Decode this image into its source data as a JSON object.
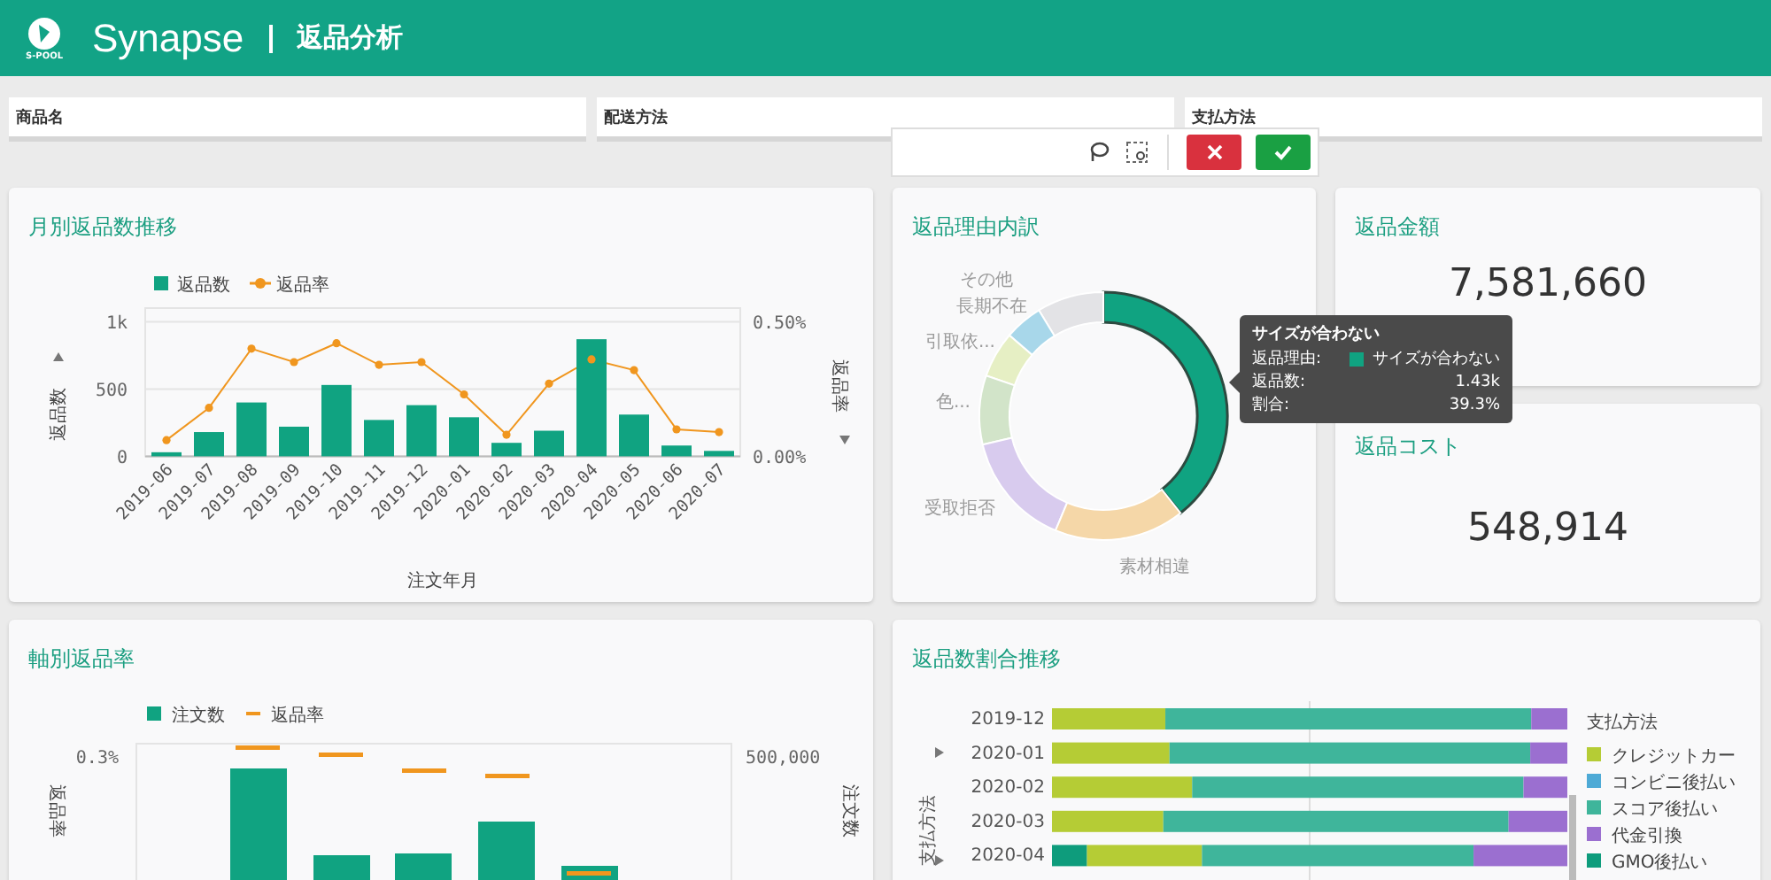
{
  "header": {
    "logo_caption": "S-POOL",
    "app_name": "Synapse",
    "page_title": "返品分析"
  },
  "filters": [
    {
      "label": "商品名"
    },
    {
      "label": "配送方法"
    },
    {
      "label": "支払方法"
    }
  ],
  "monthly_returns": {
    "title": "月別返品数推移",
    "chart_data": {
      "type": "bar",
      "xlabel": "注文年月",
      "ylabel": "返品数",
      "y2label": "返品率",
      "categories": [
        "2019-06",
        "2019-07",
        "2019-08",
        "2019-09",
        "2019-10",
        "2019-11",
        "2019-12",
        "2020-01",
        "2020-02",
        "2020-03",
        "2020-04",
        "2020-05",
        "2020-06",
        "2020-07"
      ],
      "legend": "top",
      "series": [
        {
          "name": "返品数",
          "color": "#10a381",
          "type": "bar",
          "values": [
            30,
            180,
            400,
            220,
            530,
            270,
            380,
            290,
            100,
            190,
            870,
            310,
            80,
            40
          ]
        },
        {
          "name": "返品率",
          "color": "#f0961e",
          "type": "line",
          "axis": "y2",
          "marker": "circle",
          "values": [
            0.06,
            0.18,
            0.4,
            0.35,
            0.42,
            0.34,
            0.35,
            0.23,
            0.08,
            0.27,
            0.36,
            0.32,
            0.1,
            0.09
          ]
        }
      ],
      "ylim": [
        0,
        1000
      ],
      "yticks": [
        0,
        500,
        {
          "value": 1000,
          "label": "1k"
        }
      ],
      "y2lim": [
        0,
        0.5
      ],
      "y2ticks": [
        {
          "value": 0,
          "label": "0.00%"
        },
        {
          "value": 0.5,
          "label": "0.50%"
        }
      ]
    }
  },
  "return_reasons": {
    "title": "返品理由内訳",
    "slices": [
      {
        "color": "#10a381",
        "selected": true
      },
      {
        "label": "その他",
        "color": "#e3e3e6",
        "selected": false
      },
      {
        "label": "長期不在",
        "color": "#a8d7ea",
        "selected": false
      },
      {
        "label": "引取依...",
        "color": "#e6efc4",
        "selected": false
      },
      {
        "label": "色...",
        "color": "#d2e4c9",
        "selected": false
      },
      {
        "label": "受取拒否",
        "color": "#d8cbee",
        "selected": false
      },
      {
        "label": "素材相違",
        "color": "#f5d7a8",
        "selected": false
      }
    ],
    "tooltip": {
      "title": "サイズが合わない",
      "rows": [
        {
          "key": "返品理由:",
          "value": "サイズが合わない",
          "color": "#10a381"
        },
        {
          "key": "返品数:",
          "value": "1.43k"
        },
        {
          "key": "割合:",
          "value": "39.3%"
        }
      ]
    }
  },
  "kpis": [
    {
      "title": "返品金額",
      "value": "7,581,660"
    },
    {
      "title": "返品コスト",
      "value": "548,914"
    }
  ],
  "order_return_rate": {
    "title": "軸別返品率",
    "legend": [
      {
        "label": "注文数",
        "kind": "bar",
        "color": "#10a381"
      },
      {
        "label": "返品率",
        "kind": "line",
        "color": "#f0961e"
      }
    ],
    "ylabel": "返品率",
    "y2label": "注文数",
    "ytick": "0.3%",
    "y2tick": "500,000"
  },
  "return_share_trend": {
    "title": "返品数割合推移",
    "ylabel": "支払方法",
    "categories": [
      "2019-12",
      "2020-01",
      "2020-02",
      "2020-03",
      "2020-04"
    ],
    "legend_title": "支払方法",
    "legend": [
      {
        "label": "クレジットカー",
        "color": "#b5cc35"
      },
      {
        "label": "コンビニ後払い",
        "color": "#4eaad6"
      },
      {
        "label": "スコア後払い",
        "color": "#3fb59b"
      },
      {
        "label": "代金引換",
        "color": "#9b6fd0"
      },
      {
        "label": "GMO後払い",
        "color": "#0e9c7c"
      }
    ]
  }
}
